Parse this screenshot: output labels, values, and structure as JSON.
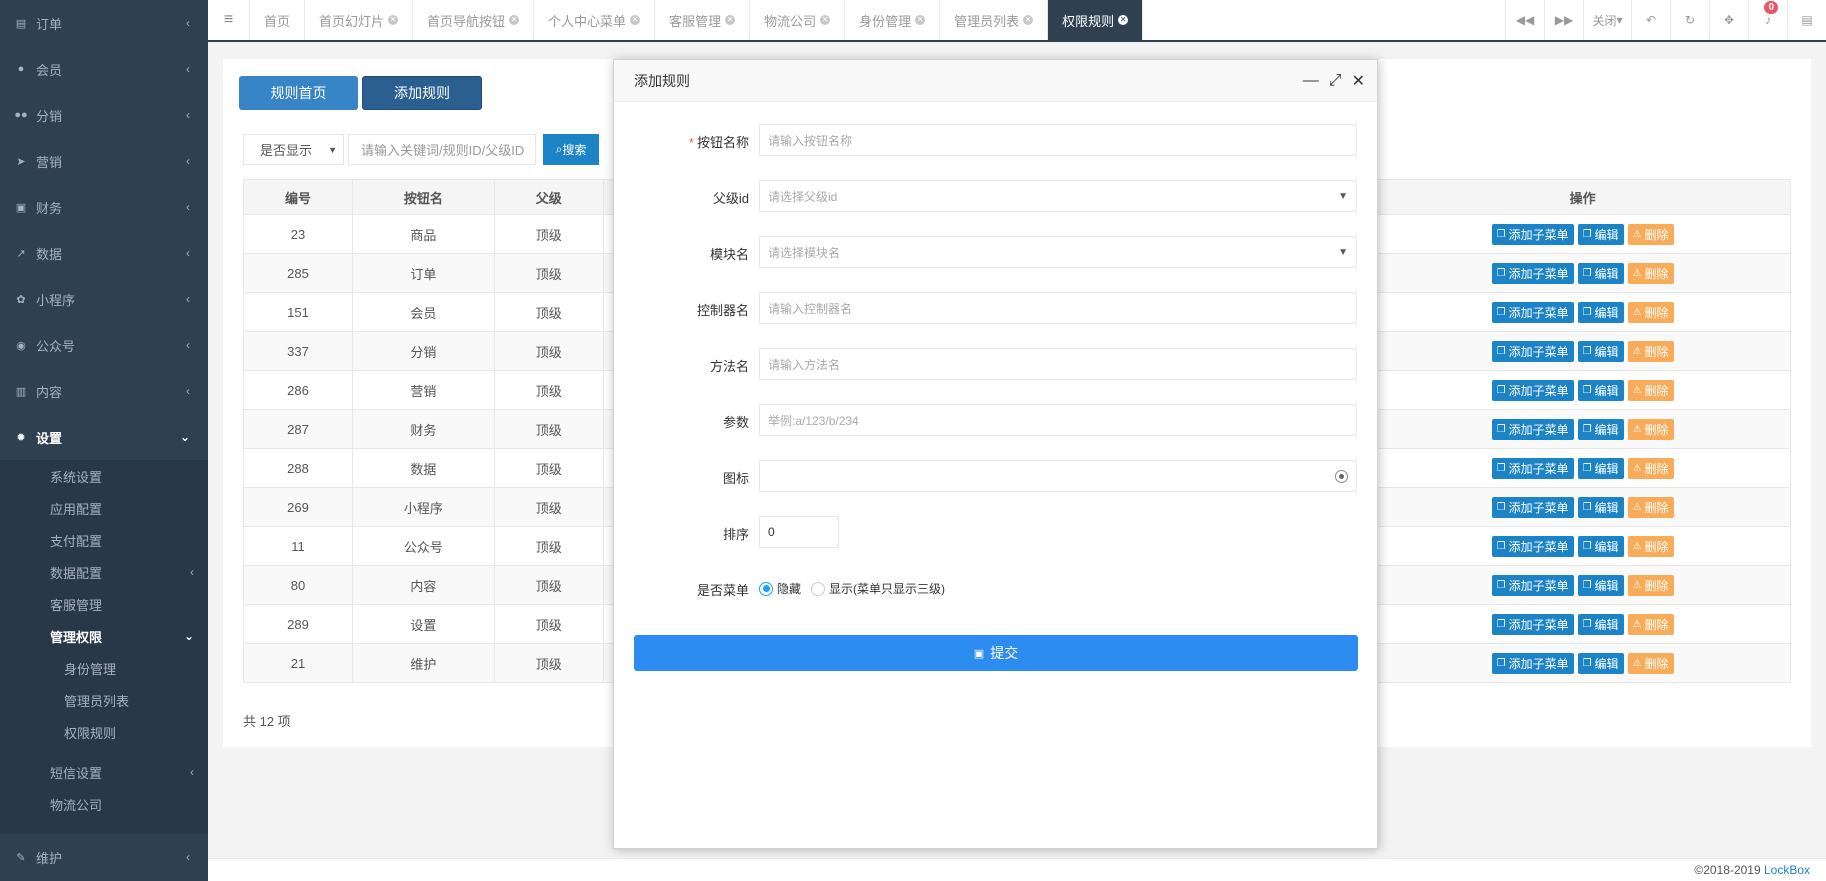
{
  "sidebar": {
    "items": [
      {
        "label": "订单",
        "icon": "order-icon"
      },
      {
        "label": "会员",
        "icon": "user-icon"
      },
      {
        "label": "分销",
        "icon": "users-icon"
      },
      {
        "label": "营销",
        "icon": "send-icon"
      },
      {
        "label": "财务",
        "icon": "money-icon"
      },
      {
        "label": "数据",
        "icon": "chart-icon"
      },
      {
        "label": "小程序",
        "icon": "mini-program-icon"
      },
      {
        "label": "公众号",
        "icon": "wechat-icon"
      },
      {
        "label": "内容",
        "icon": "book-icon"
      },
      {
        "label": "设置",
        "icon": "gear-icon"
      }
    ],
    "settings_sub": [
      "系统设置",
      "应用配置",
      "支付配置",
      "数据配置",
      "客服管理",
      "管理权限"
    ],
    "auth_sub": [
      "身份管理",
      "管理员列表",
      "权限规则"
    ],
    "settings_sub2": [
      "短信设置",
      "物流公司"
    ],
    "last_item": "维护"
  },
  "topbar": {
    "tabs": [
      "首页",
      "首页幻灯片",
      "首页导航按钮",
      "个人中心菜单",
      "客服管理",
      "物流公司",
      "身份管理",
      "管理员列表",
      "权限规则"
    ],
    "close_label": "关闭",
    "notif_count": "0"
  },
  "page": {
    "btn_home": "规则首页",
    "btn_add": "添加规则",
    "filter_select": "是否显示",
    "search_placeholder": "请输入关键词/规则ID/父级ID",
    "search_btn": "搜索",
    "total": "共 12 项"
  },
  "table": {
    "headers": [
      "编号",
      "按钮名",
      "父级",
      "操作"
    ],
    "rows": [
      {
        "id": "23",
        "name": "商品",
        "parent": "顶级"
      },
      {
        "id": "285",
        "name": "订单",
        "parent": "顶级"
      },
      {
        "id": "151",
        "name": "会员",
        "parent": "顶级"
      },
      {
        "id": "337",
        "name": "分销",
        "parent": "顶级"
      },
      {
        "id": "286",
        "name": "营销",
        "parent": "顶级"
      },
      {
        "id": "287",
        "name": "财务",
        "parent": "顶级"
      },
      {
        "id": "288",
        "name": "数据",
        "parent": "顶级"
      },
      {
        "id": "269",
        "name": "小程序",
        "parent": "顶级"
      },
      {
        "id": "11",
        "name": "公众号",
        "parent": "顶级"
      },
      {
        "id": "80",
        "name": "内容",
        "parent": "顶级"
      },
      {
        "id": "289",
        "name": "设置",
        "parent": "顶级"
      },
      {
        "id": "21",
        "name": "维护",
        "parent": "顶级"
      }
    ],
    "ops": {
      "add_child": "添加子菜单",
      "edit": "编辑",
      "delete": "删除"
    }
  },
  "modal": {
    "title": "添加规则",
    "fields": [
      {
        "label": "按钮名称",
        "placeholder": "请输入按钮名称",
        "required": true
      },
      {
        "label": "父级id",
        "placeholder": "请选择父级id"
      },
      {
        "label": "模块名",
        "placeholder": "请选择模块名"
      },
      {
        "label": "控制器名",
        "placeholder": "请输入控制器名"
      },
      {
        "label": "方法名",
        "placeholder": "请输入方法名"
      },
      {
        "label": "参数",
        "placeholder": "举例:a/123/b/234"
      },
      {
        "label": "图标",
        "placeholder": ""
      },
      {
        "label": "排序",
        "value": "0"
      },
      {
        "label": "是否菜单"
      }
    ],
    "radio_hide": "隐藏",
    "radio_show": "显示(菜单只显示三级)",
    "submit": "提交"
  },
  "footer": {
    "copyright": "©2018-2019 ",
    "brand": "LockBox"
  }
}
